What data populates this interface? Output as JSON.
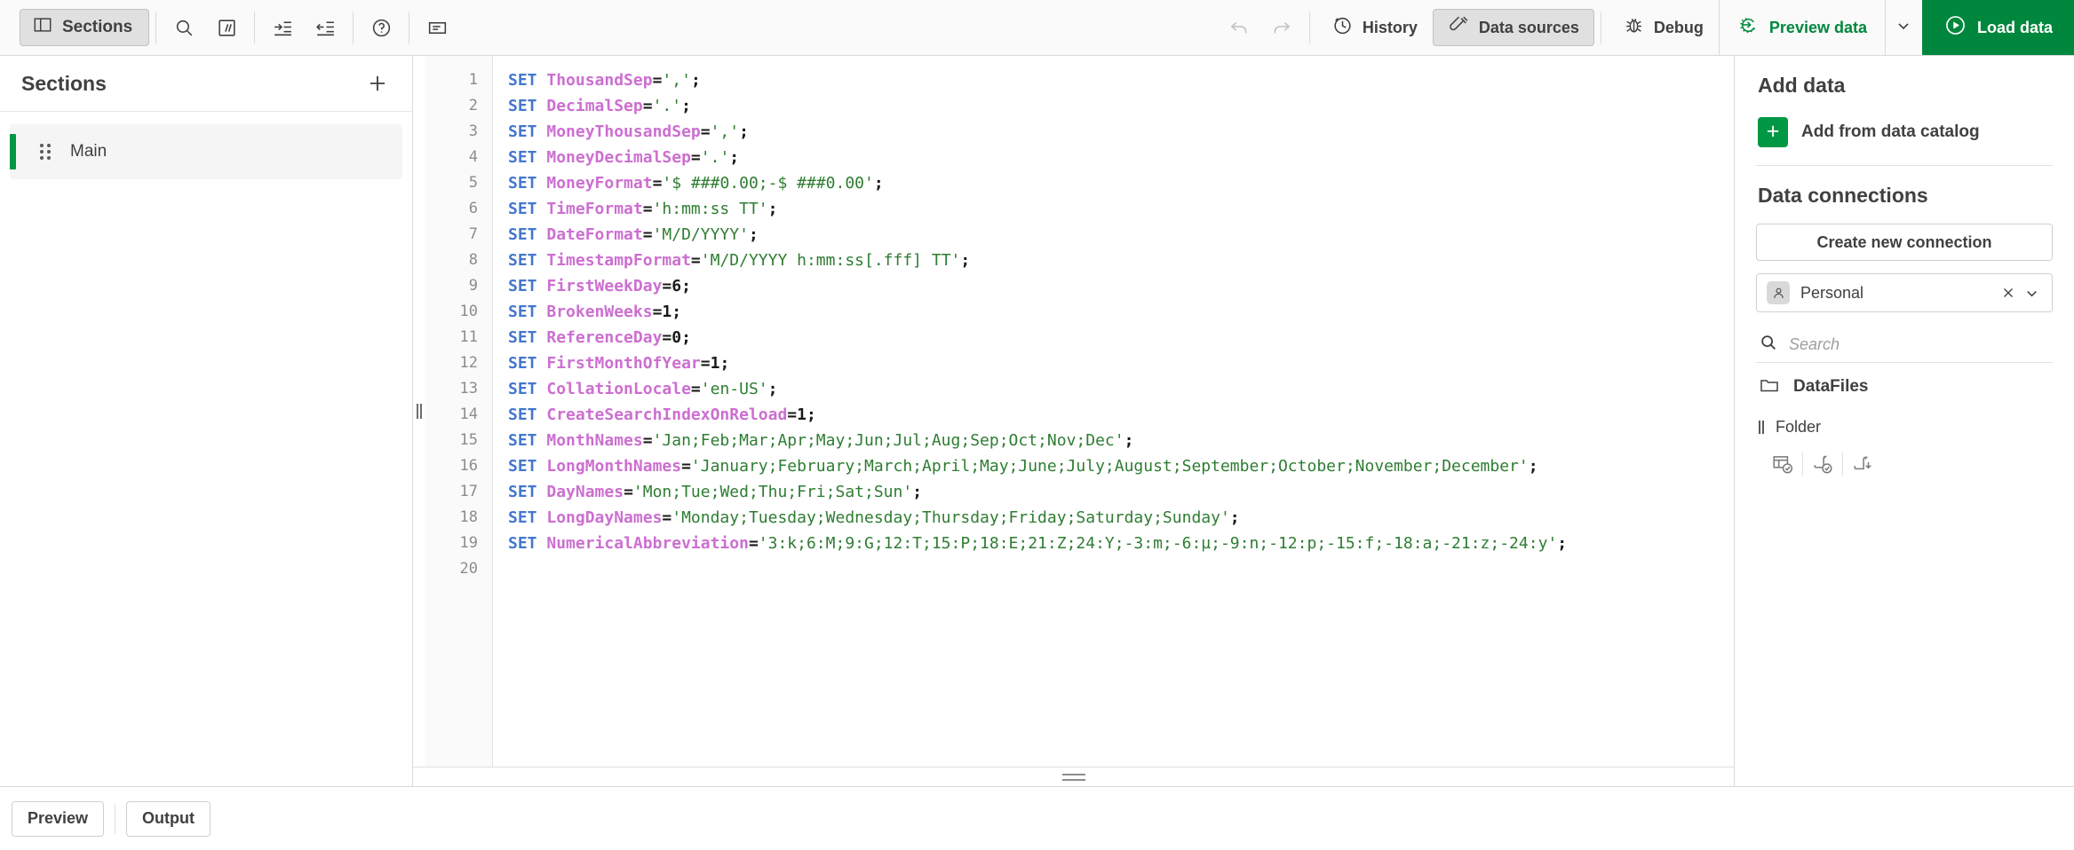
{
  "toolbar": {
    "sections_button": "Sections",
    "icons": [
      {
        "name": "search-icon",
        "title": "Search"
      },
      {
        "name": "comment-icon",
        "title": "//"
      },
      {
        "name": "indent-icon",
        "title": "Indent"
      },
      {
        "name": "outdent-icon",
        "title": "Outdent"
      },
      {
        "name": "help-icon",
        "title": "Help"
      },
      {
        "name": "variables-icon",
        "title": "Variables"
      }
    ],
    "undo_label": "Undo",
    "redo_label": "Redo",
    "history": "History",
    "data_sources": "Data sources",
    "debug": "Debug",
    "preview_data": "Preview data",
    "load_data": "Load data",
    "accent_green": "#00873d",
    "load_bg": "#00873d"
  },
  "sections": {
    "title": "Sections",
    "add_label": "+",
    "items": [
      {
        "label": "Main",
        "selected": true
      }
    ]
  },
  "editor": {
    "line_numbers": [
      "1",
      "2",
      "3",
      "4",
      "5",
      "6",
      "7",
      "8",
      "9",
      "10",
      "11",
      "12",
      "13",
      "14",
      "15",
      "16",
      "17",
      "18",
      "19",
      "20"
    ],
    "lines": [
      {
        "n": 1,
        "kw": "SET",
        "var": "ThousandSep",
        "eq": "=",
        "val": "','",
        "valtype": "string",
        "end": ";"
      },
      {
        "n": 2,
        "kw": "SET",
        "var": "DecimalSep",
        "eq": "=",
        "val": "'.'",
        "valtype": "string",
        "end": ";"
      },
      {
        "n": 3,
        "kw": "SET",
        "var": "MoneyThousandSep",
        "eq": "=",
        "val": "','",
        "valtype": "string",
        "end": ";"
      },
      {
        "n": 4,
        "kw": "SET",
        "var": "MoneyDecimalSep",
        "eq": "=",
        "val": "'.'",
        "valtype": "string",
        "end": ";"
      },
      {
        "n": 5,
        "kw": "SET",
        "var": "MoneyFormat",
        "eq": "=",
        "val": "'$ ###0.00;-$ ###0.00'",
        "valtype": "string",
        "end": ";"
      },
      {
        "n": 6,
        "kw": "SET",
        "var": "TimeFormat",
        "eq": "=",
        "val": "'h:mm:ss TT'",
        "valtype": "string",
        "end": ";"
      },
      {
        "n": 7,
        "kw": "SET",
        "var": "DateFormat",
        "eq": "=",
        "val": "'M/D/YYYY'",
        "valtype": "string",
        "end": ";"
      },
      {
        "n": 8,
        "kw": "SET",
        "var": "TimestampFormat",
        "eq": "=",
        "val": "'M/D/YYYY h:mm:ss[.fff] TT'",
        "valtype": "string",
        "end": ";"
      },
      {
        "n": 9,
        "kw": "SET",
        "var": "FirstWeekDay",
        "eq": "=",
        "val": "6",
        "valtype": "number",
        "end": ";"
      },
      {
        "n": 10,
        "kw": "SET",
        "var": "BrokenWeeks",
        "eq": "=",
        "val": "1",
        "valtype": "number",
        "end": ";"
      },
      {
        "n": 11,
        "kw": "SET",
        "var": "ReferenceDay",
        "eq": "=",
        "val": "0",
        "valtype": "number",
        "end": ";"
      },
      {
        "n": 12,
        "kw": "SET",
        "var": "FirstMonthOfYear",
        "eq": "=",
        "val": "1",
        "valtype": "number",
        "end": ";"
      },
      {
        "n": 13,
        "kw": "SET",
        "var": "CollationLocale",
        "eq": "=",
        "val": "'en-US'",
        "valtype": "string",
        "end": ";"
      },
      {
        "n": 14,
        "kw": "SET",
        "var": "CreateSearchIndexOnReload",
        "eq": "=",
        "val": "1",
        "valtype": "number",
        "end": ";"
      },
      {
        "n": 15,
        "kw": "SET",
        "var": "MonthNames",
        "eq": "=",
        "val": "'Jan;Feb;Mar;Apr;May;Jun;Jul;Aug;Sep;Oct;Nov;Dec'",
        "valtype": "string",
        "end": ";"
      },
      {
        "n": 16,
        "kw": "SET",
        "var": "LongMonthNames",
        "eq": "=",
        "val": "'January;February;March;April;May;June;July;August;September;October;November;December'",
        "valtype": "string",
        "end": ";"
      },
      {
        "n": 17,
        "kw": "SET",
        "var": "DayNames",
        "eq": "=",
        "val": "'Mon;Tue;Wed;Thu;Fri;Sat;Sun'",
        "valtype": "string",
        "end": ";"
      },
      {
        "n": 18,
        "kw": "SET",
        "var": "LongDayNames",
        "eq": "=",
        "val": "'Monday;Tuesday;Wednesday;Thursday;Friday;Saturday;Sunday'",
        "valtype": "string",
        "end": ";"
      },
      {
        "n": 19,
        "kw": "SET",
        "var": "NumericalAbbreviation",
        "eq": "=",
        "val": "'3:k;6:M;9:G;12:T;15:P;18:E;21:Z;24:Y;-3:m;-6:µ;-9:n;-12:p;-15:f;-18:a;-21:z;-24:y'",
        "valtype": "string",
        "end": ";"
      },
      {
        "n": 20,
        "kw": "",
        "var": "",
        "eq": "",
        "val": "",
        "valtype": "none",
        "end": ""
      }
    ],
    "colors": {
      "keyword": "#4477cc",
      "variable": "#cc6fd0",
      "string": "#2e7d32",
      "operator": "#1a1a1a",
      "gutter_text": "#8c8c8c"
    }
  },
  "data_panel": {
    "title": "Add data",
    "catalog_label": "Add from data catalog",
    "connections_title": "Data connections",
    "create_connection": "Create new connection",
    "selected_connection": "Personal",
    "search_placeholder": "Search",
    "folder_name": "DataFiles",
    "folder_type": "Folder",
    "action_icons": [
      {
        "name": "select-data-icon"
      },
      {
        "name": "select-script-icon"
      },
      {
        "name": "insert-script-icon"
      }
    ]
  },
  "bottom": {
    "preview": "Preview",
    "output": "Output"
  }
}
